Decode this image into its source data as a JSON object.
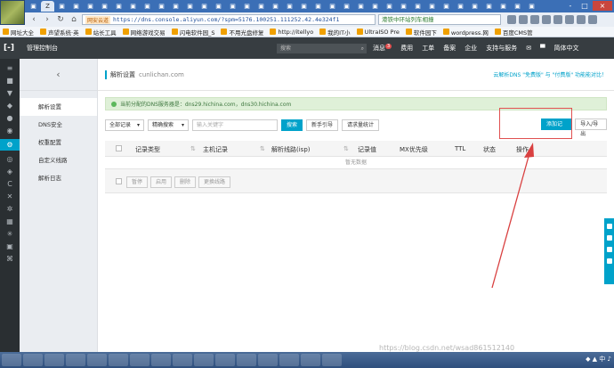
{
  "browser": {
    "tab_icons": [
      "tab-favicon"
    ],
    "active_tab_label": "Z",
    "secure_label": "网安云道",
    "url": "https://dns.console.aliyun.com/?spm=5176.100251.111252.42.4e324f1",
    "addr_extra": "港铁中环站列车相撞",
    "window_controls": [
      "-",
      "□",
      "×"
    ]
  },
  "bookmarks": [
    "网址大全",
    "声望系统·英",
    "站长工具",
    "网络游戏交易",
    "闪电软件园_S",
    "不用光盘修复",
    "http://itellyo",
    "我的IT小",
    "UltraISO Pre",
    "软件园下",
    "wordpress.网",
    "百度CMS管"
  ],
  "topbar": {
    "logo": "[-]",
    "console_title": "管理控制台",
    "search_placeholder": "搜索",
    "nav": [
      "消息",
      "费用",
      "工单",
      "备案",
      "企业",
      "支持与服务"
    ],
    "message_badge": "3",
    "language": "简体中文"
  },
  "subnav": {
    "items": [
      "解析设置",
      "DNS安全",
      "权重配置",
      "自定义线路",
      "解析日志"
    ],
    "active_index": 0
  },
  "page": {
    "title": "解析设置",
    "domain": "cunlichan.com",
    "head_links": "云解析DNS \"免费版\" 与 \"付费版\" 功能能对比！"
  },
  "notice": {
    "text": "当前分配的DNS服务器是：dns29.hichina.com，dns30.hichina.com"
  },
  "filters": {
    "record_select": "全部记录",
    "search_mode_select": "精确搜索",
    "keyword_placeholder": "输入关键字",
    "search_button": "搜索",
    "guide_button": "新手引导",
    "stats_button": "请求量统计",
    "add_record_button": "添加记录",
    "import_export_button": "导入/导出"
  },
  "table": {
    "headers": [
      "记录类型",
      "主机记录",
      "解析线路(isp)",
      "记录值",
      "MX优先级",
      "TTL",
      "状态",
      "操作"
    ],
    "empty_text": "暂无数据",
    "bulk_buttons": [
      "暂停",
      "启用",
      "删除",
      "更换线路"
    ]
  },
  "watermark": "https://blog.csdn.net/wsad861512140",
  "tray": "◆ ▲ 中 ♪"
}
